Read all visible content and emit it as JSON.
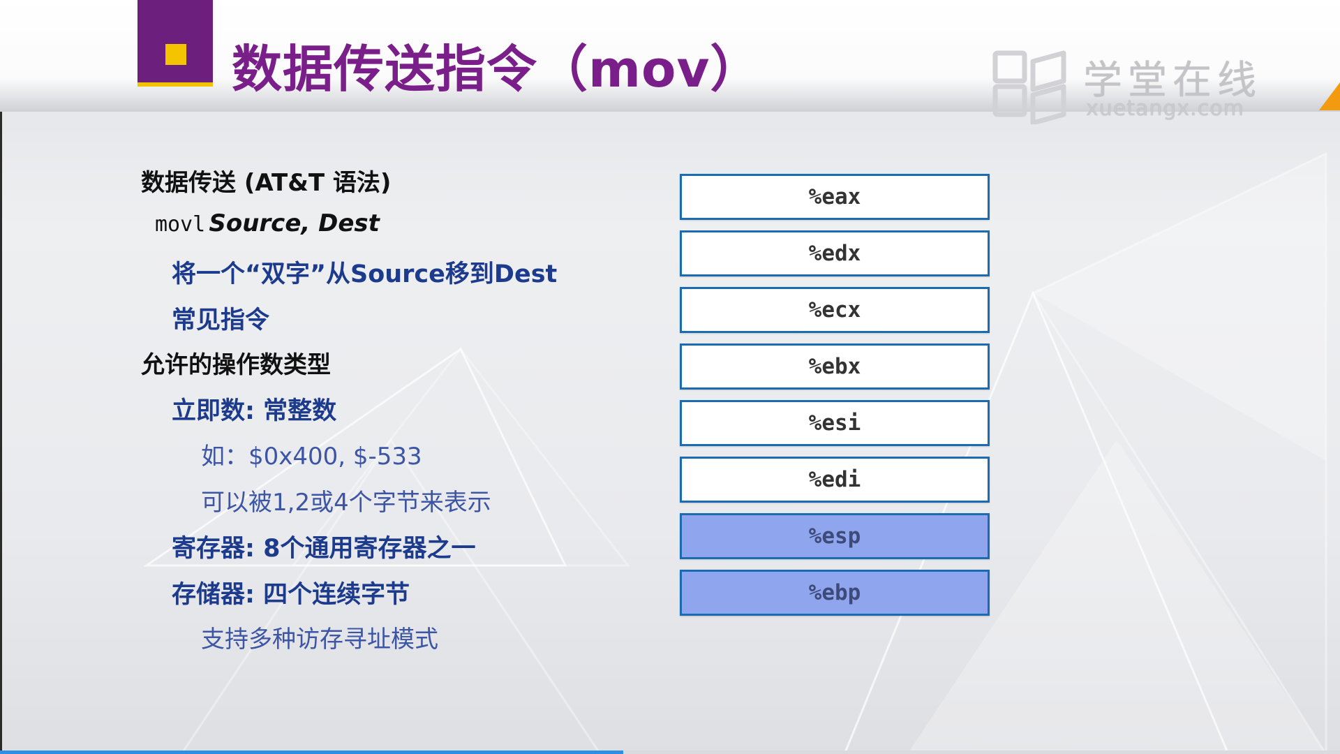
{
  "slide": {
    "title": "数据传送指令（mov）",
    "watermark": {
      "cn": "学堂在线",
      "en": "xuetangx.com",
      "icon": "book-logo-icon"
    }
  },
  "lines": {
    "l1": "数据传送 (AT&T 语法)",
    "l2_code": "movl",
    "l2_args": "Source, Dest",
    "l3": "将一个“双字”从Source移到Dest",
    "l4": "常见指令",
    "l5": "允许的操作数类型",
    "l6": "立即数: 常整数",
    "l7": "如：$0x400, $-533",
    "l8": "可以被1,2或4个字节来表示",
    "l9": "寄存器: 8个通用寄存器之一",
    "l10": "存储器: 四个连续字节",
    "l11": "支持多种访存寻址模式"
  },
  "registers": [
    {
      "name": "%eax",
      "highlight": false
    },
    {
      "name": "%edx",
      "highlight": false
    },
    {
      "name": "%ecx",
      "highlight": false
    },
    {
      "name": "%ebx",
      "highlight": false
    },
    {
      "name": "%esi",
      "highlight": false
    },
    {
      "name": "%edi",
      "highlight": false
    },
    {
      "name": "%esp",
      "highlight": true
    },
    {
      "name": "%ebp",
      "highlight": true
    }
  ],
  "video": {
    "progress": 0.465
  },
  "colors": {
    "title_purple": "#7a1e8a",
    "accent_yellow": "#f5c400",
    "text_blue": "#1d3b8c",
    "register_border": "#1a6bb0",
    "register_highlight": "#8fa6ee",
    "progress": "#2f8ee6"
  }
}
